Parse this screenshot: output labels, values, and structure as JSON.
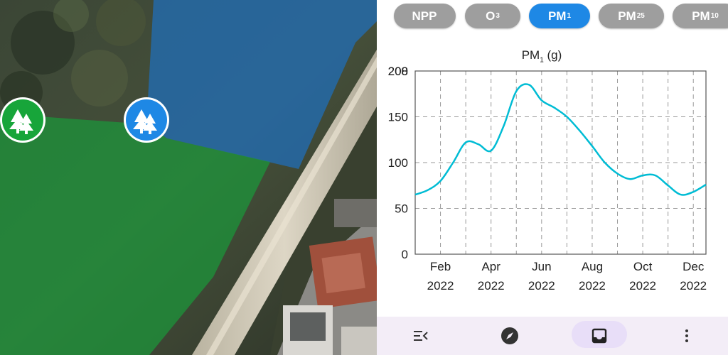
{
  "tabs": [
    {
      "label": "NPP",
      "sub": "",
      "active": false
    },
    {
      "label": "O",
      "sub": "3",
      "active": false
    },
    {
      "label": "PM",
      "sub": "1",
      "active": true
    },
    {
      "label": "PM",
      "sub": "25",
      "active": false
    },
    {
      "label": "PM",
      "sub": "10",
      "active": false
    }
  ],
  "chart_data": {
    "type": "line",
    "title": "PM₁ (g)",
    "title_main": "PM",
    "title_sub": "1",
    "title_unit": " (g)",
    "ylim": [
      0,
      200
    ],
    "y_ticks": [
      {
        "label": "0",
        "value": 0
      },
      {
        "label": "50",
        "value": 50
      },
      {
        "label": "100",
        "value": 100
      },
      {
        "label": "150",
        "value": 150
      },
      {
        "label": "200",
        "value": 200
      },
      {
        "label": "208",
        "value": 200
      }
    ],
    "x_labels": [
      {
        "month": "Feb",
        "year": "2022",
        "pos": 1
      },
      {
        "month": "Apr",
        "year": "2022",
        "pos": 3
      },
      {
        "month": "Jun",
        "year": "2022",
        "pos": 5
      },
      {
        "month": "Aug",
        "year": "2022",
        "pos": 7
      },
      {
        "month": "Oct",
        "year": "2022",
        "pos": 9
      },
      {
        "month": "Dec",
        "year": "2022",
        "pos": 11
      }
    ],
    "grid": true,
    "series": [
      {
        "color": "#00bcd4",
        "x": [
          0,
          0.5,
          1,
          1.5,
          2,
          2.5,
          3,
          3.5,
          4,
          4.5,
          5,
          5.5,
          6,
          6.5,
          7,
          7.5,
          8,
          8.5,
          9,
          9.5,
          10,
          10.5,
          11,
          11.5
        ],
        "values": [
          65,
          70,
          80,
          100,
          122,
          120,
          113,
          140,
          178,
          185,
          168,
          160,
          150,
          135,
          118,
          100,
          88,
          82,
          86,
          86,
          75,
          65,
          68,
          76
        ]
      }
    ]
  },
  "nav": {
    "items": [
      {
        "icon": "list-collapse-icon"
      },
      {
        "icon": "compass-icon"
      },
      {
        "icon": "inbox-icon",
        "active": true
      },
      {
        "icon": "more-vert-icon"
      }
    ]
  },
  "colors": {
    "accent": "#1e88e5",
    "chip": "#9e9e9e",
    "line": "#00bcd4",
    "nav_bg": "#f3edf7",
    "nav_active": "#e8def8"
  }
}
